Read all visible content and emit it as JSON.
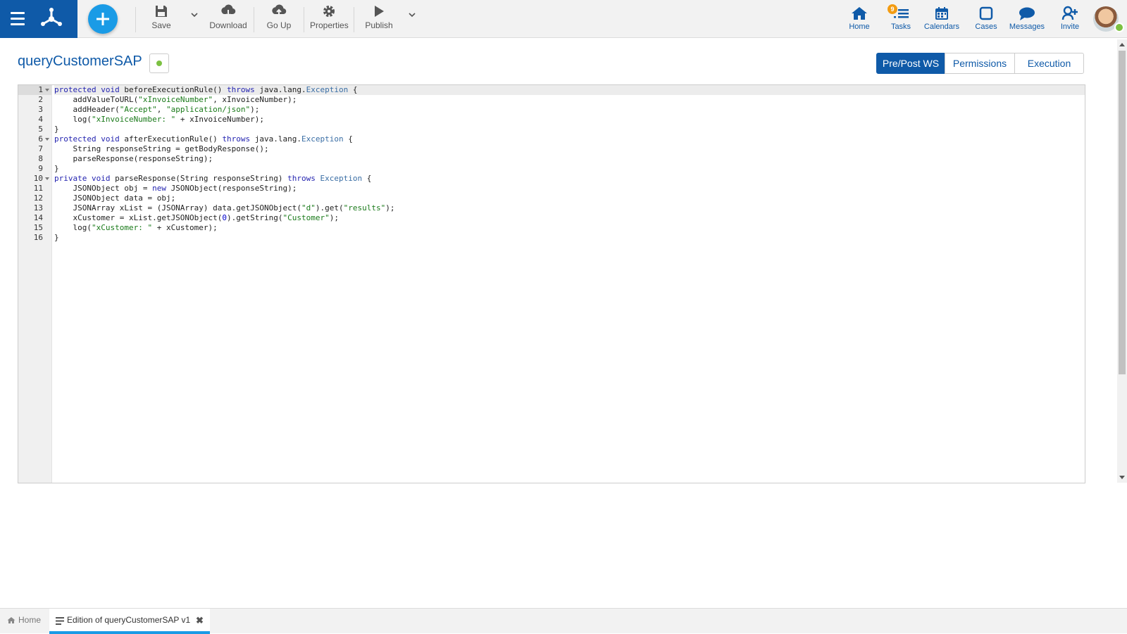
{
  "toolbar": {
    "save": "Save",
    "download": "Download",
    "go_up": "Go Up",
    "properties": "Properties",
    "publish": "Publish"
  },
  "nav": {
    "home": "Home",
    "tasks": "Tasks",
    "tasks_badge": "9",
    "calendars": "Calendars",
    "cases": "Cases",
    "messages": "Messages",
    "invite": "Invite"
  },
  "page": {
    "title": "queryCustomerSAP",
    "status_color": "#7cc142"
  },
  "tabs": [
    "Pre/Post WS",
    "Permissions",
    "Execution"
  ],
  "editor": {
    "line_numbers": [
      "1",
      "2",
      "3",
      "4",
      "5",
      "6",
      "7",
      "8",
      "9",
      "10",
      "11",
      "12",
      "13",
      "14",
      "15",
      "16"
    ],
    "lines": [
      "protected void beforeExecutionRule() throws java.lang.Exception {",
      "    addValueToURL(\"xInvoiceNumber\", xInvoiceNumber);",
      "    addHeader(\"Accept\", \"application/json\");",
      "    log(\"xInvoiceNumber: \" + xInvoiceNumber);",
      "}",
      "protected void afterExecutionRule() throws java.lang.Exception {",
      "    String responseString = getBodyResponse();",
      "    parseResponse(responseString);",
      "}",
      "private void parseResponse(String responseString) throws Exception {",
      "    JSONObject obj = new JSONObject(responseString);",
      "    JSONObject data = obj;",
      "    JSONArray xList = (JSONArray) data.getJSONObject(\"d\").get(\"results\");",
      "    xCustomer = xList.getJSONObject(0).getString(\"Customer\");",
      "    log(\"xCustomer: \" + xCustomer);",
      "}"
    ]
  },
  "bottom_tabs": {
    "home": "Home",
    "edition": "Edition of queryCustomerSAP v1",
    "close": "✖"
  },
  "colors": {
    "brand": "#0f5aa8",
    "accent": "#1a9be6",
    "badge": "#f39c12"
  }
}
